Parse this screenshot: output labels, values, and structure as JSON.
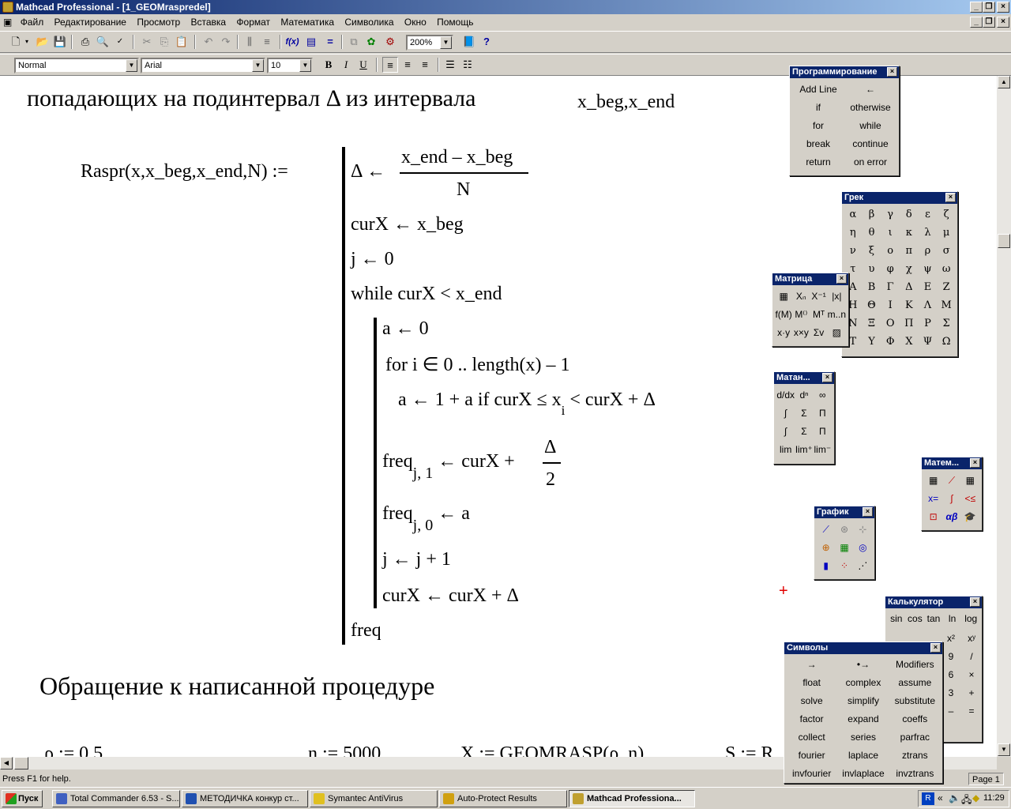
{
  "app": {
    "title": "Mathcad Professional - [1_GEOMraspredel]"
  },
  "menu": [
    "Файл",
    "Редактирование",
    "Просмотр",
    "Вставка",
    "Формат",
    "Математика",
    "Символика",
    "Окно",
    "Помощь"
  ],
  "toolbar": {
    "zoom": "200%",
    "style": "Normal",
    "font": "Arial",
    "size": "10",
    "bold": "B",
    "italic": "I",
    "underline": "U"
  },
  "doc": {
    "heading": "попадающих на подинтервал Δ из интервала",
    "heading_vars": "x_beg,x_end",
    "func_def": "Raspr(x,x_beg,x_end,N) :=",
    "l_delta": "Δ ←",
    "frac_num": "x_end – x_beg",
    "frac_den": "N",
    "l_curx": "curX ← x_beg",
    "l_j": "j ← 0",
    "l_while": "while  curX < x_end",
    "l_a": "a ← 0",
    "l_for": "for  i ∈ 0 .. length(x) – 1",
    "l_if_a": "a ← 1 + a  if  curX ≤ x",
    "l_if_sub": "i",
    "l_if_b": "< curX + Δ",
    "l_freq1": "freq",
    "l_freq1_sub": "j, 1",
    "l_freq1_rhs": "← curX +",
    "l_freq1_num": "Δ",
    "l_freq1_den": "2",
    "l_freq0": "freq",
    "l_freq0_sub": "j, 0",
    "l_freq0_rhs": "← a",
    "l_jinc": "j ← j + 1",
    "l_curxinc": "curX ← curX + Δ",
    "l_ret": "freq",
    "section2": "Обращение к написанной процедуре",
    "bottom": [
      "ρ := 0.5",
      "n := 5000",
      "X := GEOMRASP(ρ, n)",
      "S := R"
    ]
  },
  "palettes": {
    "prog": {
      "title": "Программирование",
      "items": [
        "Add Line",
        "←",
        "if",
        "otherwise",
        "for",
        "while",
        "break",
        "continue",
        "return",
        "on error"
      ]
    },
    "greek": {
      "title": "Грек",
      "items": [
        "α",
        "β",
        "γ",
        "δ",
        "ε",
        "ζ",
        "η",
        "θ",
        "ι",
        "κ",
        "λ",
        "μ",
        "ν",
        "ξ",
        "ο",
        "π",
        "ρ",
        "σ",
        "τ",
        "υ",
        "φ",
        "χ",
        "ψ",
        "ω",
        "Α",
        "Β",
        "Γ",
        "Δ",
        "Ε",
        "Ζ",
        "Η",
        "Θ",
        "Ι",
        "Κ",
        "Λ",
        "Μ",
        "Ν",
        "Ξ",
        "Ο",
        "Π",
        "Ρ",
        "Σ",
        "Τ",
        "Υ",
        "Φ",
        "Χ",
        "Ψ",
        "Ω"
      ]
    },
    "matrix": {
      "title": "Матрица"
    },
    "calculus": {
      "title": "Матан..."
    },
    "math": {
      "title": "Матем..."
    },
    "graph": {
      "title": "График"
    },
    "calc": {
      "title": "Калькулятор",
      "row1": [
        "sin",
        "cos",
        "tan",
        "ln",
        "log"
      ],
      "right": [
        "x²",
        "xʸ",
        "9",
        "/",
        "6",
        "×",
        "3",
        "+",
        "–",
        "="
      ]
    },
    "symbols": {
      "title": "Символы",
      "items": [
        "→",
        "•→",
        "Modifiers",
        "float",
        "complex",
        "assume",
        "solve",
        "simplify",
        "substitute",
        "factor",
        "expand",
        "coeffs",
        "collect",
        "series",
        "parfrac",
        "fourier",
        "laplace",
        "ztrans",
        "invfourier",
        "invlaplace",
        "invztrans"
      ]
    }
  },
  "status": {
    "help": "Press F1 for help.",
    "page": "Page 1"
  },
  "taskbar": {
    "start": "Пуск",
    "tasks": [
      "Total Commander 6.53 - S...",
      "МЕТОДИЧКА конкур ст...",
      "Symantec AntiVirus",
      "Auto-Protect Results",
      "Mathcad Professiona..."
    ],
    "clock": "11:29"
  }
}
